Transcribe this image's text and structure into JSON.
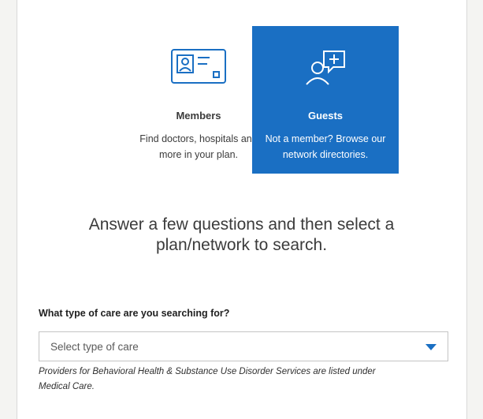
{
  "tiles": {
    "members": {
      "title": "Members",
      "description": "Find doctors, hospitals and more in your plan.",
      "icon": "id-card-icon"
    },
    "guests": {
      "title": "Guests",
      "description": "Not a member? Browse our network directories.",
      "icon": "person-chat-plus-icon",
      "selected": true
    }
  },
  "headline": "Answer a few questions and then select a plan/network to search.",
  "care_question": {
    "label": "What type of care are you searching for?",
    "select_value": "Select type of care",
    "helper": "Providers for Behavioral Health & Substance Use Disorder Services are listed under Medical Care."
  },
  "colors": {
    "accent": "#1a6fc3",
    "text": "#3b3b3b",
    "background": "#ffffff"
  }
}
